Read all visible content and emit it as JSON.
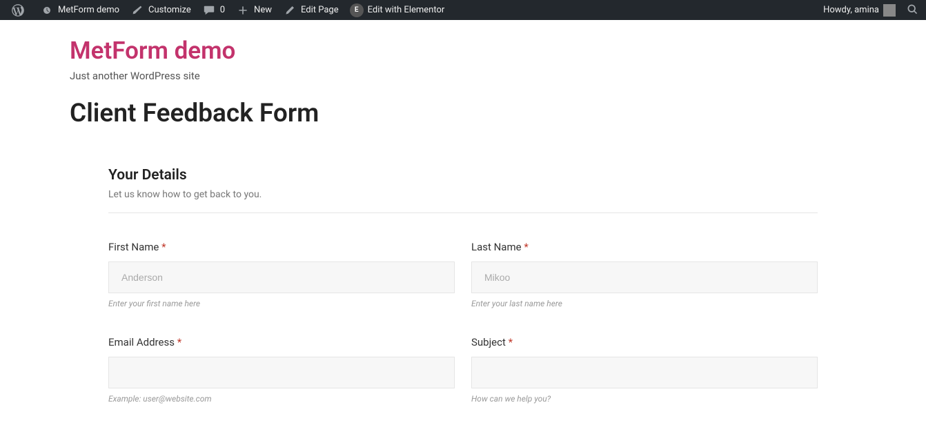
{
  "adminbar": {
    "site_name": "MetForm demo",
    "customize": "Customize",
    "comments_count": "0",
    "new": "New",
    "edit_page": "Edit Page",
    "edit_elementor": "Edit with Elementor",
    "howdy": "Howdy, amina"
  },
  "site": {
    "title": "MetForm demo",
    "tagline": "Just another WordPress site"
  },
  "page": {
    "title": "Client Feedback Form"
  },
  "form": {
    "section_title": "Your Details",
    "section_sub": "Let us know how to get back to you.",
    "first_name": {
      "label": "First Name",
      "placeholder": "Anderson",
      "help": "Enter your first name here"
    },
    "last_name": {
      "label": "Last Name",
      "placeholder": "Mikoo",
      "help": "Enter your last name here"
    },
    "email": {
      "label": "Email Address",
      "placeholder": "",
      "help": "Example: user@website.com"
    },
    "subject": {
      "label": "Subject",
      "placeholder": "",
      "help": "How can we help you?"
    }
  }
}
